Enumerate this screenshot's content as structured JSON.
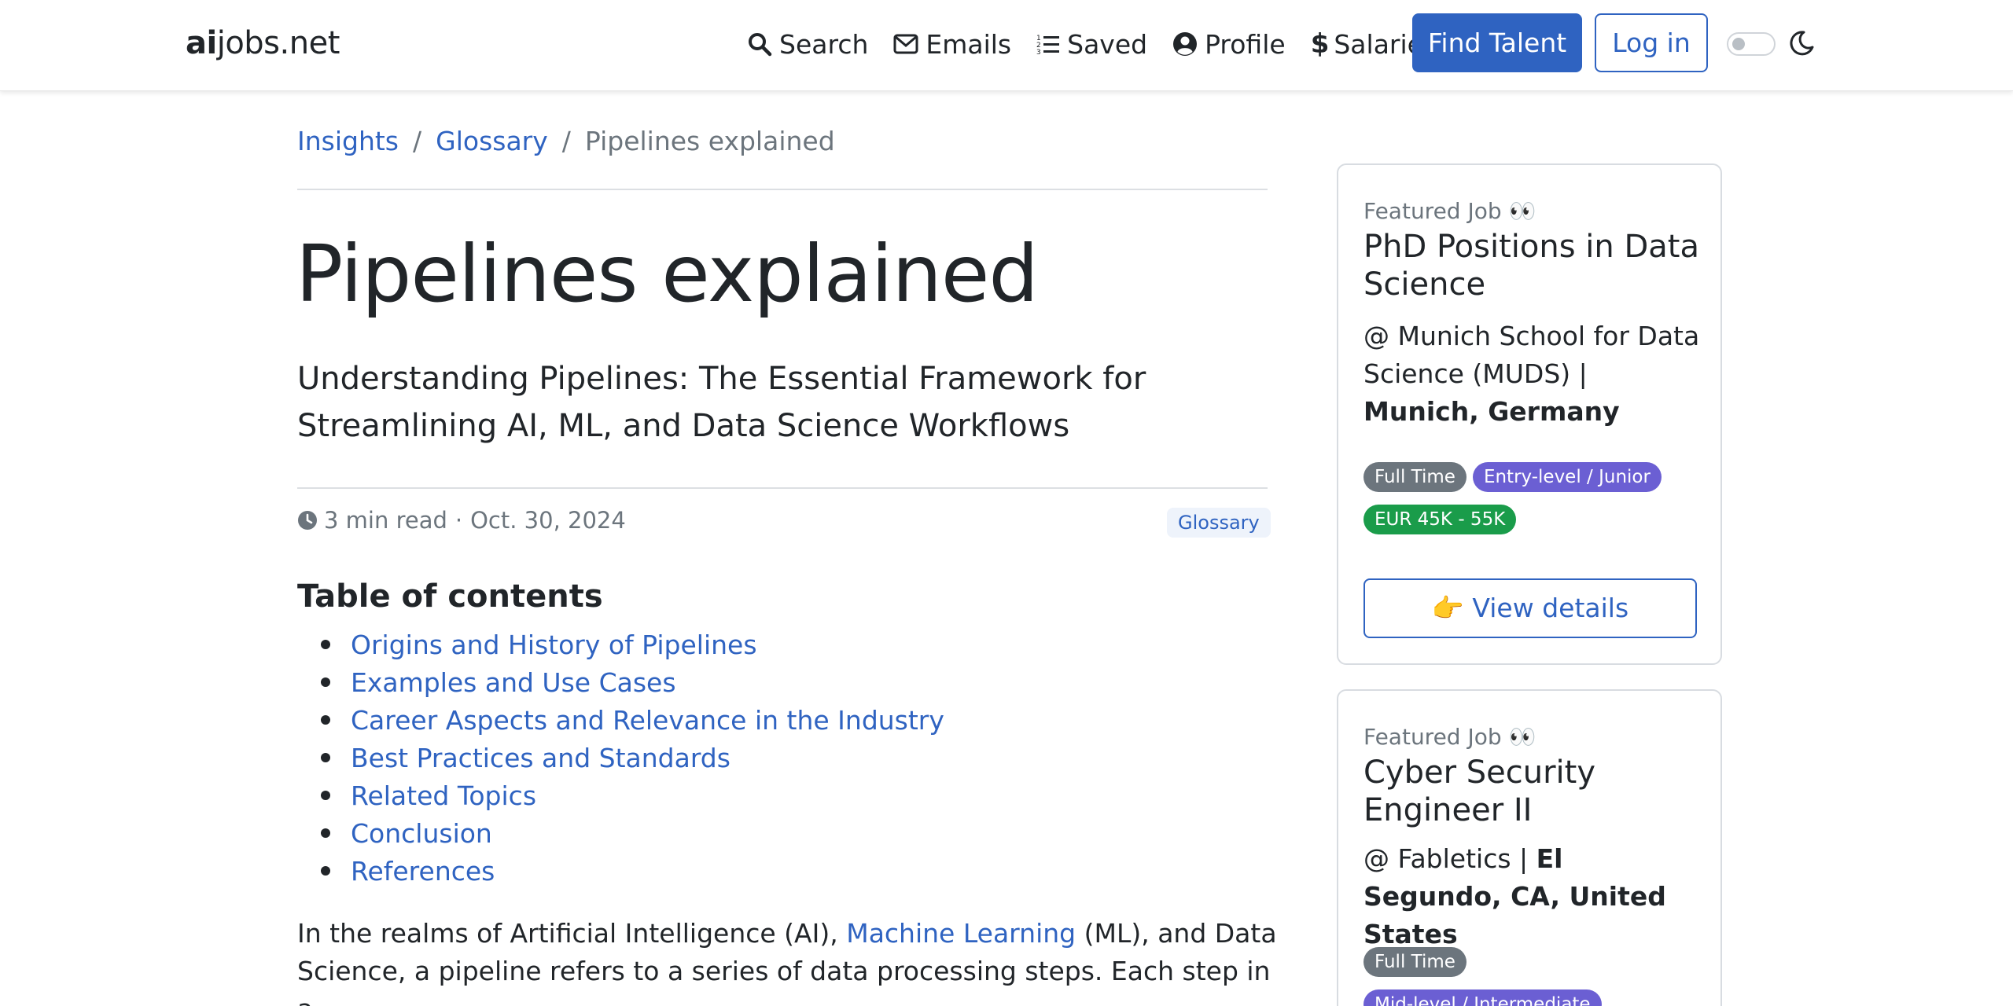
{
  "brand": {
    "bold": "ai",
    "rest": "jobs.net"
  },
  "nav": {
    "items": [
      {
        "label": "Search",
        "icon": "search-icon"
      },
      {
        "label": "Emails",
        "icon": "envelope-icon"
      },
      {
        "label": "Saved",
        "icon": "list-icon"
      },
      {
        "label": "Profile",
        "icon": "user-circle-icon"
      },
      {
        "label": "Salaries",
        "icon": "dollar-icon"
      }
    ],
    "find_talent": "Find Talent",
    "login": "Log in"
  },
  "breadcrumb": {
    "items": [
      "Insights",
      "Glossary"
    ],
    "separator": "/",
    "current": "Pipelines explained"
  },
  "article": {
    "title": "Pipelines explained",
    "subtitle": "Understanding Pipelines: The Essential Framework for Streamlining AI, ML, and Data Science Workflows",
    "read_time": "3 min read",
    "date": "Oct. 30, 2024",
    "category": "Glossary",
    "toc_title": "Table of contents",
    "toc": [
      "Origins and History of Pipelines",
      "Examples and Use Cases",
      "Career Aspects and Relevance in the Industry",
      "Best Practices and Standards",
      "Related Topics",
      "Conclusion",
      "References"
    ],
    "body": {
      "before": "In the realms of Artificial Intelligence (AI), ",
      "link": "Machine Learning",
      "after": " (ML), and Data Science, a pipeline refers to a series of data processing steps. Each step in a"
    }
  },
  "featured_jobs": [
    {
      "label": "Featured Job 👀",
      "title": "PhD Positions in Data Science",
      "company": "@ Munich School for Data Science (MUDS) | ",
      "location": "Munich, Germany",
      "badges": [
        "Full Time",
        "Entry-level / Junior",
        "EUR 45K - 55K"
      ],
      "button": "👉 View details"
    },
    {
      "label": "Featured Job 👀",
      "title": "Cyber Security Engineer II",
      "company": "@ Fabletics | ",
      "location": "El Segundo, CA, United States",
      "badges": [
        "Full Time",
        "Mid-level / Intermediate"
      ]
    }
  ],
  "colors": {
    "accent": "#2f63c1",
    "badge_gray": "#6c757d",
    "badge_purple": "#6b5fd3",
    "badge_green": "#1a9c4a"
  }
}
